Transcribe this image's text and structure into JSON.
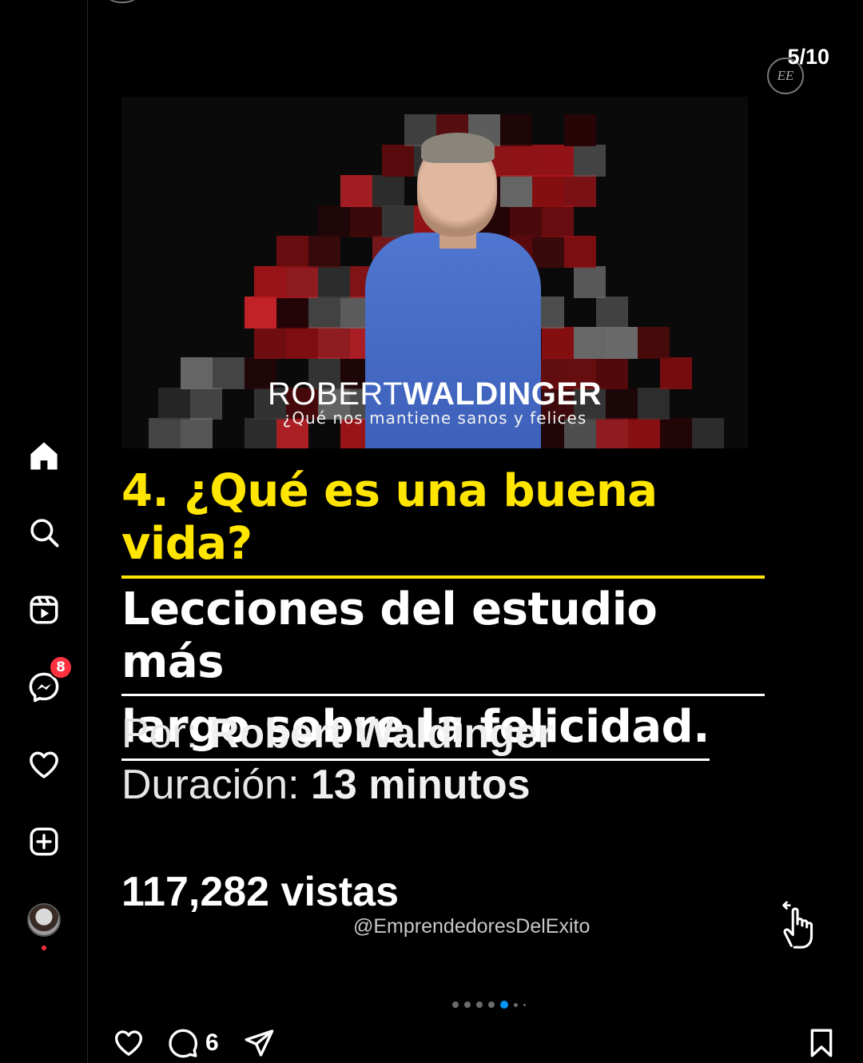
{
  "nav": {
    "items": [
      {
        "name": "home",
        "icon": "home-icon"
      },
      {
        "name": "search",
        "icon": "search-icon"
      },
      {
        "name": "reels",
        "icon": "reels-icon"
      },
      {
        "name": "messages",
        "icon": "messenger-icon",
        "badge": "8"
      },
      {
        "name": "notifications",
        "icon": "heart-icon"
      },
      {
        "name": "create",
        "icon": "plus-square-icon"
      },
      {
        "name": "profile",
        "icon": "avatar"
      }
    ],
    "messages_badge": "8"
  },
  "post": {
    "counter": "5/10",
    "seal_text": "EE",
    "video": {
      "name_light": "ROBERT",
      "name_bold": "WALDINGER",
      "subtitle": "¿Qué nos mantiene sanos y felices"
    },
    "headline": {
      "line1": "4. ¿Qué es una buena vida?",
      "line2": "Lecciones del estudio más",
      "line3": "largo sobre la felicidad."
    },
    "meta": {
      "by_label": "Por:",
      "by_value": "Robert Waldinger",
      "duration_label": "Duración:",
      "duration_value": "13 minutos"
    },
    "views": "117,282 vistas",
    "handle": "@EmprendedoresDelExito",
    "carousel": {
      "total": 7,
      "active_index": 4
    },
    "comments_count": "6"
  },
  "colors": {
    "background": "#000000",
    "headline_yellow": "#ffe500",
    "badge_red": "#ff3040",
    "active_dot": "#0095f6"
  }
}
